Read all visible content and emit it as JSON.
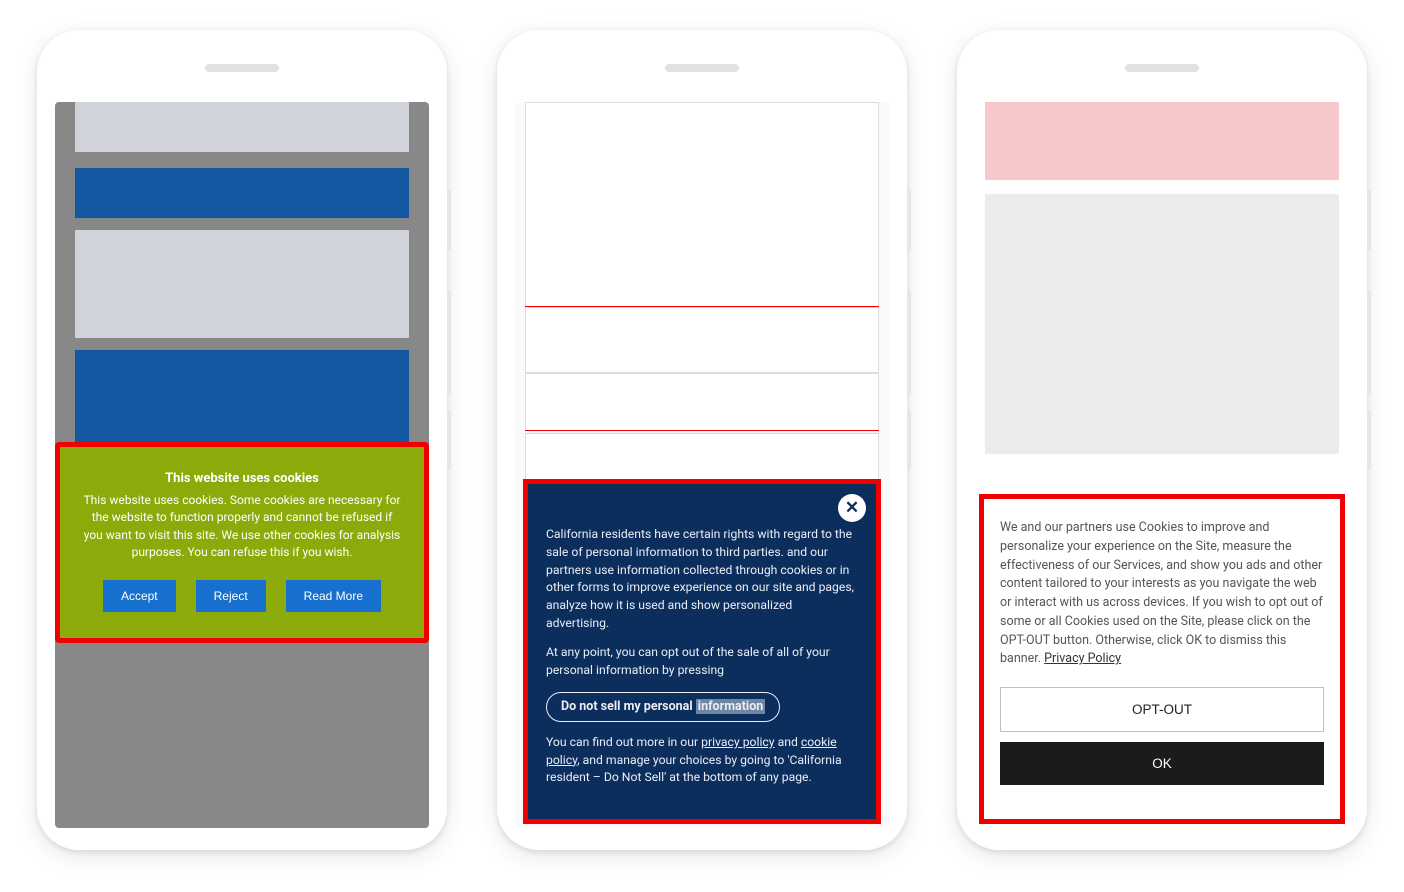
{
  "phone1": {
    "banner": {
      "title": "This website uses cookies",
      "text": "This website uses cookies. Some cookies are necessary for the website to function properly and cannot be refused if you want to visit this site. We use other cookies for analysis purposes. You can refuse this if you wish.",
      "accept": "Accept",
      "reject": "Reject",
      "read_more": "Read More"
    }
  },
  "phone2": {
    "banner": {
      "p1_a": "California residents have certain rights with regard to the sale of personal information to third parties.",
      "p1_b": " and our partners use information collected through cookies or in other forms to improve experience on our site and pages, analyze how it is used and show personalized advertising.",
      "p2": "At any point, you can opt out of the sale of all of your personal information by pressing",
      "pill_a": "Do not sell my personal ",
      "pill_b": "information",
      "p3_a": "You can find out more in our ",
      "link_privacy": "privacy policy",
      "p3_and": " and ",
      "link_cookie": "cookie policy",
      "p3_b": ", and manage your choices by going to 'California resident – Do Not Sell' at the bottom of any page.",
      "close": "✕"
    }
  },
  "phone3": {
    "banner": {
      "text_a": "We and our partners use Cookies to improve and personalize your experience on the Site, measure the effectiveness of our Services, and show you ads and other content tailored to your interests as you navigate the web or interact with us across devices. If you wish to opt out of some or all Cookies used on the Site, please click on the OPT-OUT button. Otherwise, click OK to dismiss this banner. ",
      "link_policy": "Privacy Policy",
      "opt_out": "OPT-OUT",
      "ok": "OK"
    }
  }
}
